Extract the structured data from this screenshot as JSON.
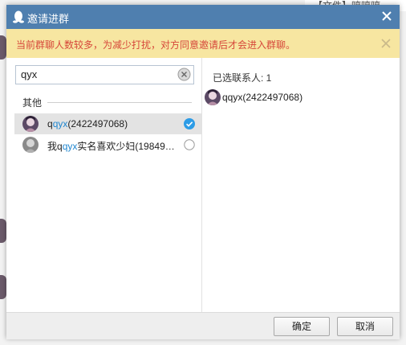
{
  "background": {
    "top_text": "【文件】哼哼哼"
  },
  "dialog": {
    "title": "邀请进群",
    "notice": "当前群聊人数较多，为减少打扰，对方同意邀请后才会进入群聊。",
    "search": {
      "value": "qyx"
    },
    "group_label": "其他",
    "results": [
      {
        "prefix": "q",
        "highlight": "qyx",
        "suffix": "(2422497068)",
        "selected": true
      },
      {
        "prefix": "我q",
        "highlight": "qyx",
        "suffix": "实名喜欢少妇(19849…",
        "selected": false
      }
    ],
    "selected_count_label": "已选联系人: 1",
    "selected": [
      {
        "name": "qqyx(2422497068)"
      }
    ],
    "buttons": {
      "ok": "确定",
      "cancel": "取消"
    }
  },
  "colors": {
    "titlebar": "#4f7faf",
    "notice_bg": "#f7e6a1",
    "notice_text": "#d6473a",
    "highlight": "#1f86cf",
    "check": "#2d9ce6"
  },
  "icons": {
    "title": "qq-penguin-icon",
    "close": "close-icon",
    "clear": "clear-search-icon",
    "checked": "checkmark-circle-icon",
    "unchecked": "empty-circle-icon"
  }
}
